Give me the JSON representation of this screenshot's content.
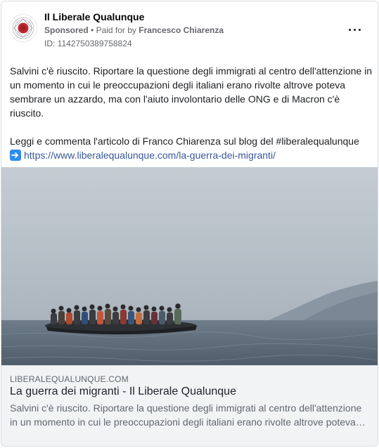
{
  "header": {
    "page_name": "Il Liberale Qualunque",
    "sponsored": "Sponsored",
    "bullet": "•",
    "paid_for_prefix": "Paid for by",
    "payer": "Francesco Chiarenza",
    "ad_id": "ID: 1142750389758824",
    "avatar_icon": "liberale-logo-icon",
    "more_icon": "more-options-icon"
  },
  "post": {
    "paragraph_1": "Salvini c'è riuscito. Riportare la questione degli immigrati al centro dell'attenzione in un momento in cui le preoccupazioni degli italiani erano rivolte altrove poteva sembrare un azzardo, ma con l'aiuto involontario delle ONG e di Macron c'è riuscito.",
    "paragraph_2": "Leggi e commenta l'articolo di Franco Chiarenza sul blog del #liberalequalunque",
    "arrow_icon": "right-arrow-emoji-icon",
    "link_url": "https://www.liberalequalunque.com/la-guerra-dei-migranti/"
  },
  "link_preview": {
    "domain": "LIBERALEQUALUNQUE.COM",
    "title": "La guerra dei migranti - Il Liberale Qualunque",
    "description_line_1": "Salvini c'è riuscito. Riportare la questione degli immigrati al centro dell'attenzione",
    "description_line_2": "in un momento in cui le preoccupazioni degli italiani erano rivolte altrove poteva…"
  },
  "colors": {
    "link": "#385898",
    "secondary_text": "#65676b",
    "preview_bg": "#f2f3f5",
    "logo_red": "#c0262d"
  }
}
